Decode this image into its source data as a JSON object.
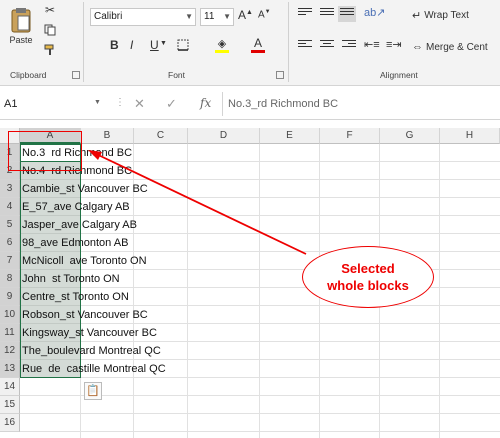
{
  "ribbon": {
    "clipboard": {
      "paste_label": "Paste",
      "group_label": "Clipboard"
    },
    "font": {
      "name": "Calibri",
      "size": "11",
      "bold": "B",
      "italic": "I",
      "underline": "U",
      "font_color_glyph": "A",
      "group_label": "Font"
    },
    "alignment": {
      "wrap_text": "Wrap Text",
      "merge_center": "Merge & Cent",
      "group_label": "Alignment"
    }
  },
  "formula_bar": {
    "name_box": "A1",
    "fx": "fx",
    "content": "No.3_rd Richmond BC"
  },
  "grid": {
    "columns": [
      "A",
      "B",
      "C",
      "D",
      "E",
      "F",
      "G",
      "H"
    ],
    "rows": [
      "1",
      "2",
      "3",
      "4",
      "5",
      "6",
      "7",
      "8",
      "9",
      "10",
      "11",
      "12",
      "13",
      "14",
      "15",
      "16"
    ],
    "cells": [
      "No.3  rd Richmond BC",
      "No.4  rd Richmond BC",
      "Cambie_st Vancouver BC",
      "E_57_ave Calgary AB",
      "Jasper_ave Calgary AB",
      "98_ave Edmonton AB",
      "McNicoll  ave Toronto ON",
      "John  st Toronto ON",
      "Centre_st Toronto ON",
      "Robson_st Vancouver BC",
      "Kingsway_st Vancouver BC",
      "The_boulevard Montreal QC",
      "Rue  de  castille Montreal QC"
    ]
  },
  "annotation": {
    "line1": "Selected",
    "line2": "whole blocks",
    "color": "#e00000"
  },
  "colors": {
    "accent": "#217346",
    "selection": "#a0afa5"
  }
}
